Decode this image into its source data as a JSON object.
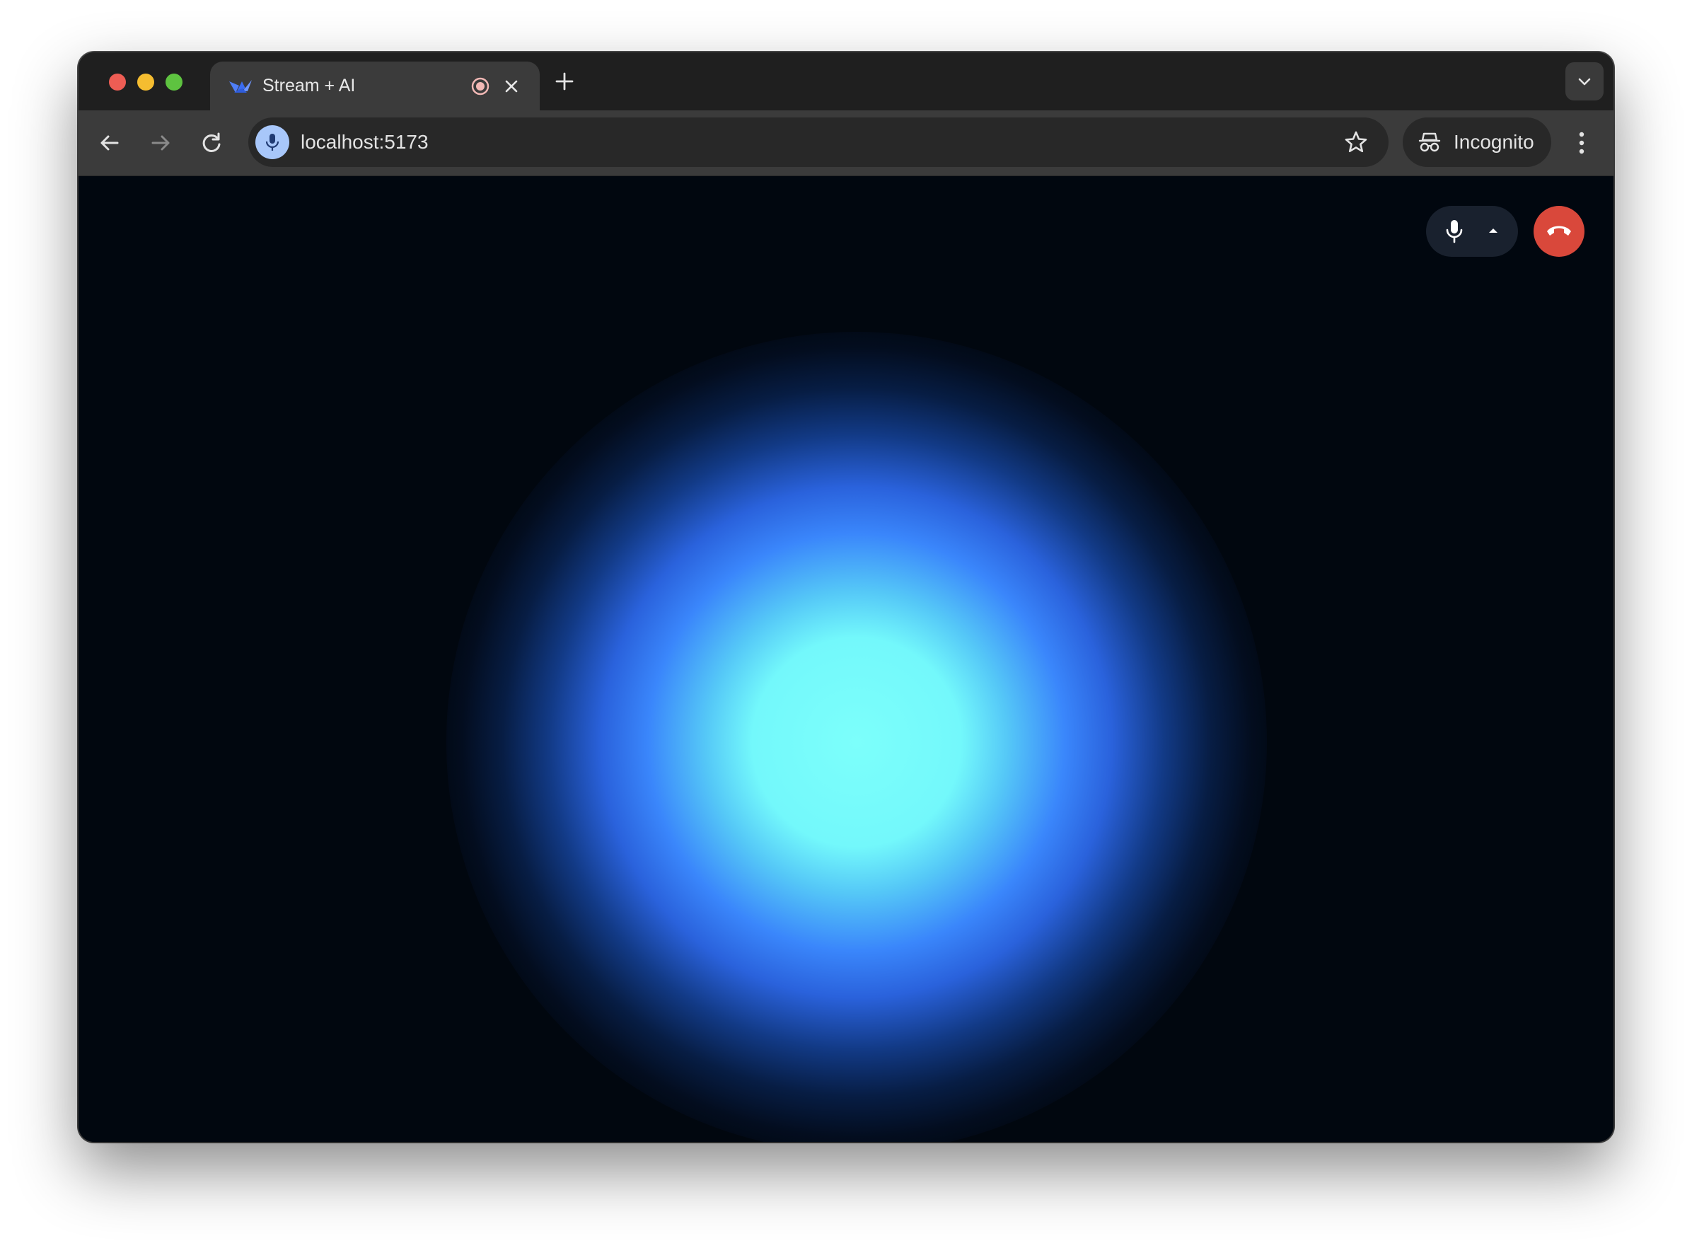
{
  "browser": {
    "tab": {
      "title": "Stream + AI",
      "favicon": "stream-logo-icon",
      "recording_indicator": "record-icon",
      "close_icon": "close-icon"
    },
    "new_tab_icon": "plus-icon",
    "tab_search_icon": "chevron-down-icon",
    "nav": {
      "back_icon": "arrow-left-icon",
      "forward_icon": "arrow-right-icon",
      "reload_icon": "reload-icon"
    },
    "address_bar": {
      "url": "localhost:5173",
      "site_indicator_icon": "microphone-icon",
      "bookmark_icon": "star-icon"
    },
    "incognito": {
      "label": "Incognito",
      "icon": "incognito-icon"
    },
    "menu_icon": "more-vertical-icon"
  },
  "page": {
    "visualizer": {
      "core_color": "#7cfffb",
      "mid_color": "#3a86fb",
      "background_color": "#01070f"
    },
    "call_controls": {
      "mic_icon": "microphone-icon",
      "options_icon": "caret-up-icon",
      "hangup_icon": "phone-hangup-icon",
      "hangup_color": "#d9483b"
    }
  }
}
